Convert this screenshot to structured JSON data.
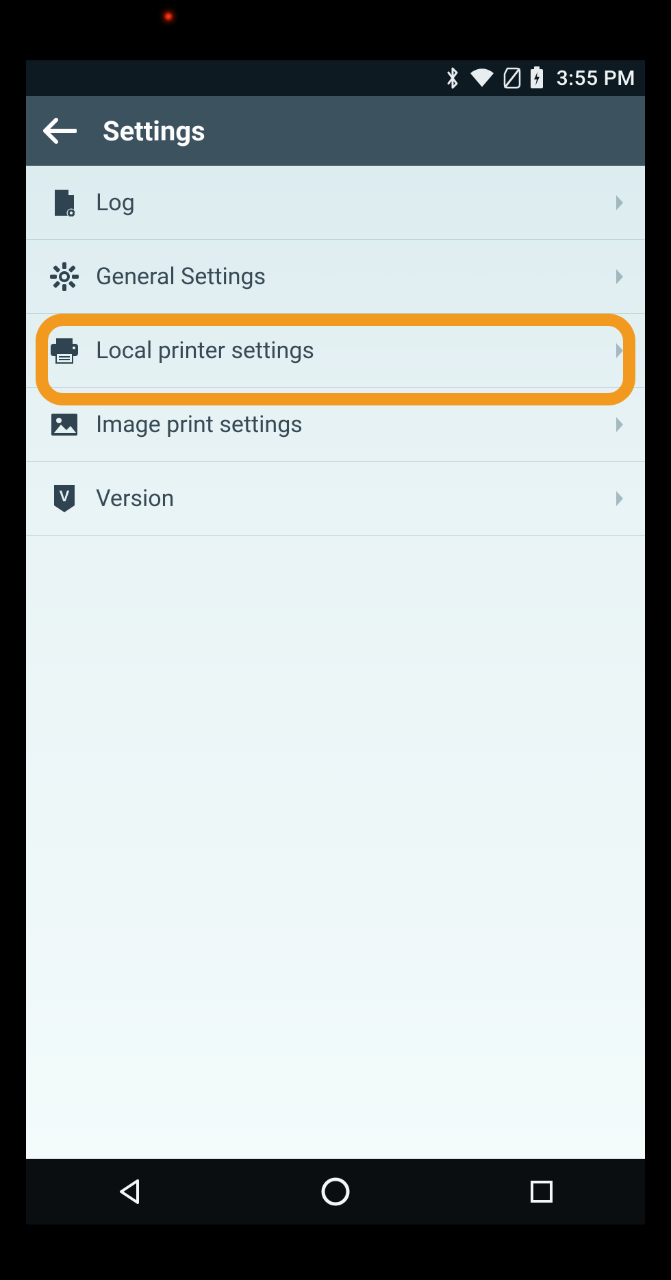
{
  "statusbar": {
    "time": "3:55 PM"
  },
  "appbar": {
    "title": "Settings"
  },
  "items": [
    {
      "label": "Log"
    },
    {
      "label": "General Settings"
    },
    {
      "label": "Local printer settings"
    },
    {
      "label": "Image print settings"
    },
    {
      "label": "Version"
    }
  ]
}
